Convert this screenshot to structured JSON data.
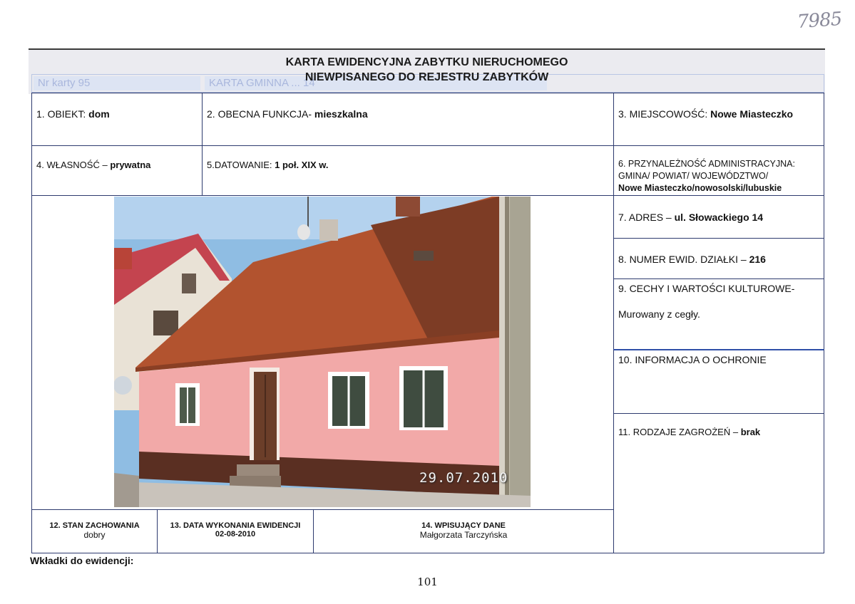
{
  "handwritten_number": "7985",
  "header": {
    "title_line1": "KARTA EWIDENCYJNA ZABYTKU NIERUCHOMEGO",
    "title_line2": "NIEWPISANEGO DO REJESTRU ZABYTKÓW",
    "ghost_nr_karty": "Nr karty 95",
    "ghost_karta_gminna": "KARTA GMINNA ... 14"
  },
  "fields": {
    "obiekt": {
      "label": "1. OBIEKT: ",
      "value": "dom"
    },
    "funkcja": {
      "label": "2. OBECNA FUNKCJA- ",
      "value": "mieszkalna"
    },
    "miejscowosc": {
      "label": "3. MIEJSCOWOŚĆ: ",
      "value": "Nowe Miasteczko"
    },
    "wlasnosc": {
      "label": "4. WŁASNOŚĆ – ",
      "value": "prywatna"
    },
    "datowanie": {
      "label": "5.DATOWANIE: ",
      "value": "1 poł. XIX w."
    },
    "przynaleznosc": {
      "label_line1": "6. PRZYNALEŻNOŚĆ ADMINISTRACYJNA:",
      "label_line2": "GMINA/ POWIAT/ WOJEWÓDZTWO/",
      "value": "Nowe Miasteczko/nowosolski/lubuskie"
    },
    "adres": {
      "label": "7. ADRES – ",
      "value": "ul. Słowackiego 14"
    },
    "numer_dzialki": {
      "label": "8. NUMER EWID. DZIAŁKI – ",
      "value": "216"
    },
    "cechy": {
      "label": "9. CECHY  I WARTOŚCI KULTUROWE-",
      "value": "Murowany z cegły."
    },
    "ochrona": {
      "label": "10. INFORMACJA O OCHRONIE"
    },
    "zagrozenia": {
      "label": "11. RODZAJE ZAGROŻEŃ – ",
      "value": "brak"
    }
  },
  "footer": {
    "stan": {
      "label": "12. STAN ZACHOWANIA",
      "value": "dobry"
    },
    "data": {
      "label": "13. DATA WYKONANIA EWIDENCJI",
      "value": "02-08-2010"
    },
    "wpisujacy": {
      "label": "14. WPISUJĄCY DANE",
      "value": "Małgorzata Tarczyńska"
    }
  },
  "photo": {
    "date_stamp": "29.07.2010"
  },
  "wkladki": "Wkładki do ewidencji:",
  "page_number": "101",
  "colors": {
    "border": "#2d3a6e",
    "wall": "#f2a9a8",
    "roof": "#b2532f",
    "sky": "#8fbde3"
  }
}
